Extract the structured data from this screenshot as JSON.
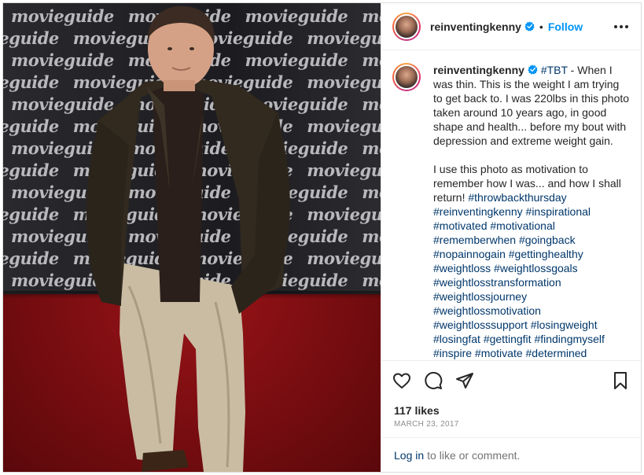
{
  "post": {
    "username": "reinventingkenny",
    "follow_label": "Follow",
    "separator": "•",
    "photo_backdrop_text": "MOVIEGUIDE"
  },
  "caption": {
    "username": "reinventingkenny",
    "first_tag": "#TBT",
    "para1": " - When I was thin. This is the weight I am trying to get back to. I was 220lbs in this photo taken around 10 years ago, in good shape and health... before my bout with depression and extreme weight gain.",
    "para2": "I use this photo as motivation to remember how I was... and how I shall return! ",
    "hashtags": [
      "#throwbackthursday",
      "#reinventingkenny",
      "#inspirational",
      "#motivated",
      "#motivational",
      "#rememberwhen",
      "#goingback",
      "#nopainnogain",
      "#gettinghealthy",
      "#weightloss",
      "#weightlossgoals",
      "#weightlosstransformation",
      "#weightlossjourney",
      "#weightlossmotivation",
      "#weightlosssupport",
      "#losingweight",
      "#losingfat",
      "#gettingfit",
      "#findingmyself",
      "#inspire",
      "#motivate",
      "#determined"
    ]
  },
  "stats": {
    "likes": "117 likes",
    "date": "MARCH 23, 2017"
  },
  "comment_bar": {
    "login_label": "Log in",
    "rest": "to like or comment."
  },
  "colors": {
    "accent": "#0095f6",
    "hashtag": "#00376b",
    "muted": "#8e8e8e"
  }
}
